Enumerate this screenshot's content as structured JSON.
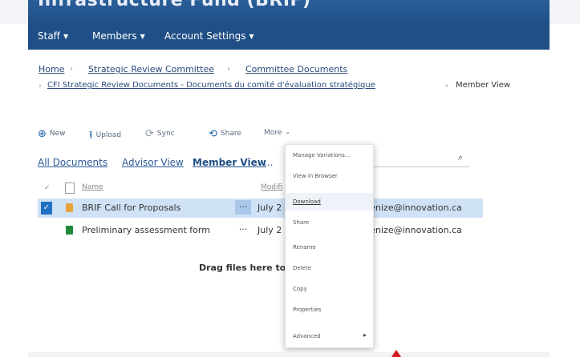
{
  "header": {
    "title": "Infrastructure Fund (BRIF)"
  },
  "nav": {
    "items": [
      {
        "label": "Staff"
      },
      {
        "label": "Members"
      },
      {
        "label": "Account Settings"
      }
    ]
  },
  "breadcrumb": {
    "home": "Home",
    "strategic_review": "Strategic Review Committee",
    "committee_docs": "Committee Documents",
    "cfi_docs": "CFI Strategic Review Documents - Documents du comité d'évaluation stratégique",
    "member_view": "Member View"
  },
  "commands": {
    "new": "New",
    "upload": "Upload",
    "sync": "Sync",
    "share": "Share",
    "more": "More"
  },
  "views": {
    "all_documents": "All Documents",
    "advisor_view": "Advisor View",
    "member_view": "Member View",
    "ellipsis": "..."
  },
  "table": {
    "col_name": "Name",
    "col_modified": "Modifi"
  },
  "files": [
    {
      "name": "BRIF Call for Proposals",
      "modified": "July 2",
      "modified_by": "Jenize@innovation.ca",
      "icon": "pdf-icon",
      "icon_color": "#e8a33a"
    },
    {
      "name": "Preliminary assessment form",
      "modified": "July 2",
      "modified_by": "Jenize@innovation.ca",
      "icon": "excel-icon",
      "icon_color": "#1f8a3a"
    }
  ],
  "drop_hint": "Drag files here to",
  "context_menu": {
    "items": [
      {
        "label": "Manage Variations..."
      },
      {
        "label": "View in Browser"
      },
      {
        "label": "Download"
      },
      {
        "label": "Share"
      },
      {
        "label": "Rename"
      },
      {
        "label": "Delete"
      },
      {
        "label": "Copy"
      },
      {
        "label": "Properties"
      },
      {
        "label": "Advanced"
      }
    ]
  },
  "colors": {
    "nav_bg": "#1f4f86",
    "selected_row": "#cfe2f6",
    "accent": "#1f6fc2"
  }
}
